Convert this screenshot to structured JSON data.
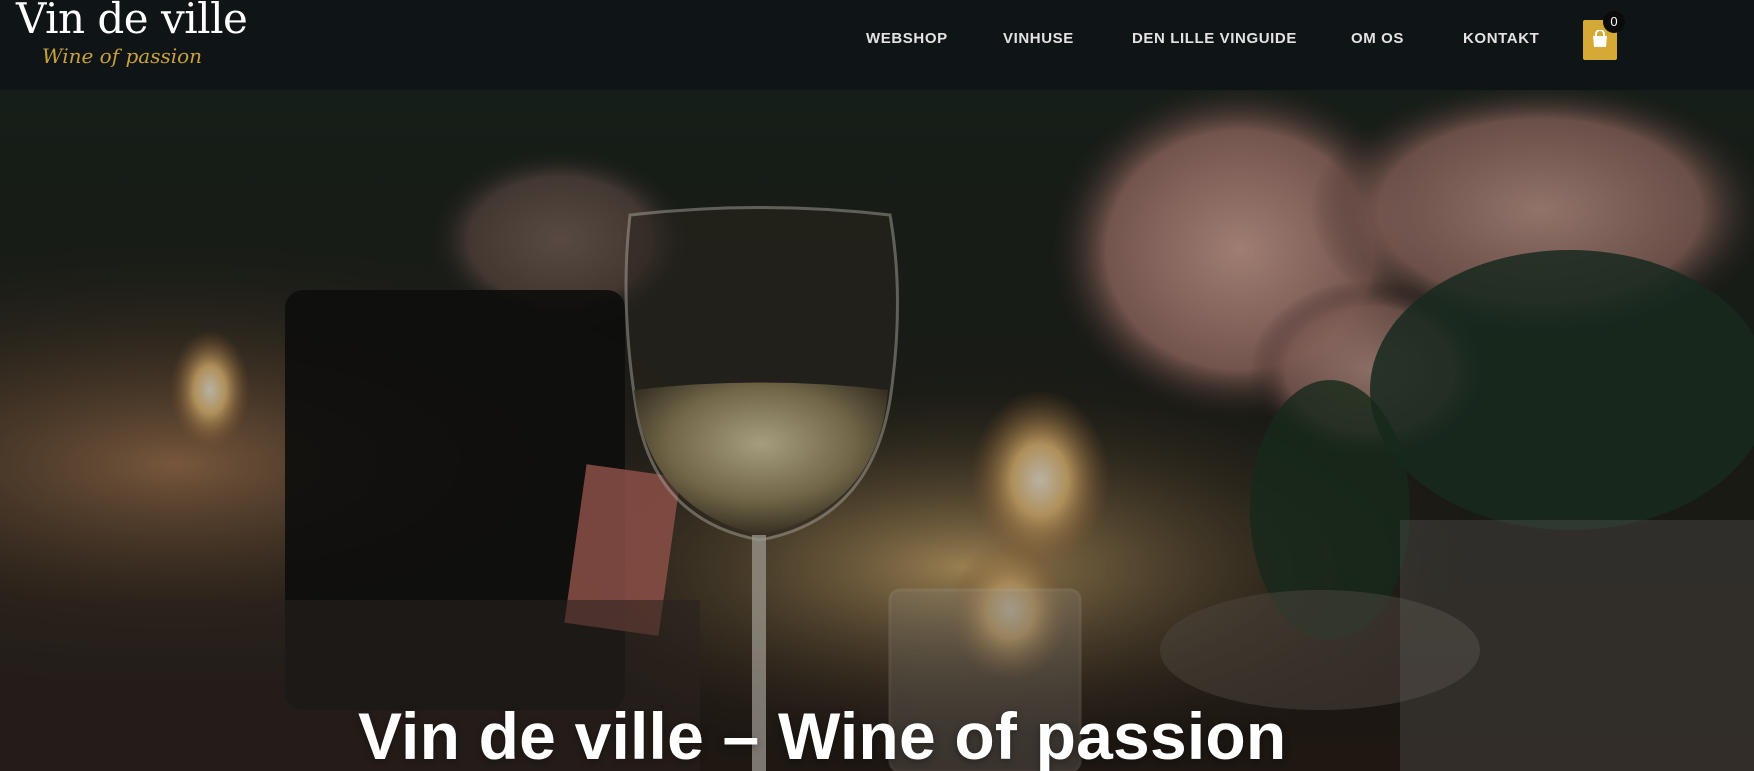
{
  "brand": {
    "name": "Vin de ville",
    "tagline": "Wine of passion"
  },
  "nav": {
    "items": [
      {
        "label": "WEBSHOP"
      },
      {
        "label": "VINHUSE"
      },
      {
        "label": "DEN LILLE VINGUIDE"
      },
      {
        "label": "OM OS"
      },
      {
        "label": "KONTAKT"
      }
    ]
  },
  "cart": {
    "count": "0",
    "icon": "shopping-bag-icon"
  },
  "hero": {
    "title": "Vin de ville – Wine of passion",
    "image": "wine-glass-candlelight-table-photo"
  },
  "colors": {
    "header_bg": "#0f1417",
    "accent": "#d4a935",
    "nav_text": "#e3e3e3"
  }
}
